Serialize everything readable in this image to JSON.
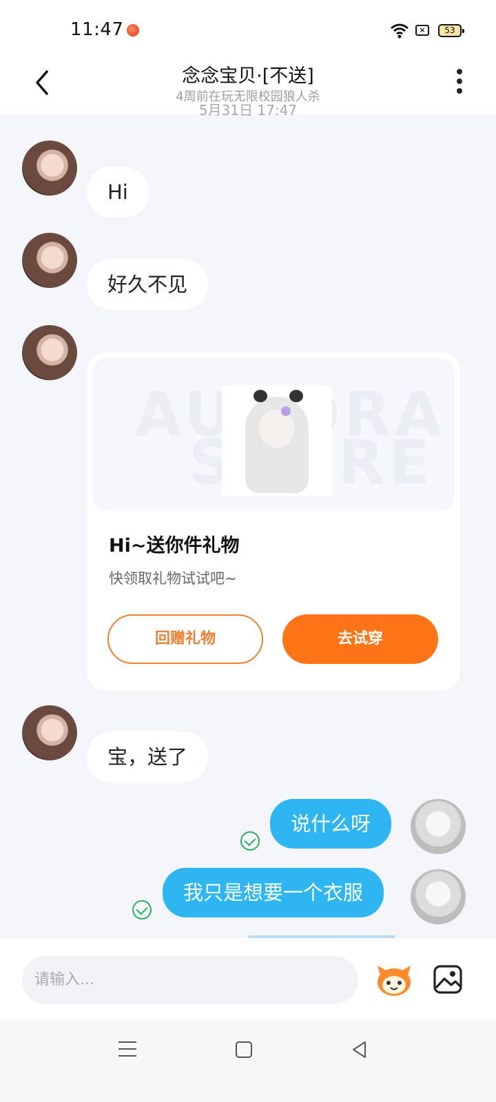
{
  "status_bar": {
    "time": "11:47",
    "battery": "53"
  },
  "header": {
    "title": "念念宝贝·[不送]",
    "subtitle": "4周前在玩无限校园狼人杀"
  },
  "timestamp": "5月31日 17:47",
  "messages": {
    "m1": "Hi",
    "m2": "好久不见",
    "m3": "宝，送了",
    "m4": "说什么呀",
    "m5": "我只是想要一个衣服"
  },
  "gift_card": {
    "watermark_line1": "AURORA",
    "watermark_line2": "STORE",
    "title": "Hi~送你件礼物",
    "description": "快领取礼物试试吧~",
    "return_gift_button": "回赠礼物",
    "try_on_button": "去试穿"
  },
  "input": {
    "placeholder": "请输入..."
  },
  "icons": {
    "back": "chevron-left-icon",
    "more": "more-vertical-icon",
    "read": "check-circle-icon",
    "emoji": "mascot-sticker-icon",
    "image": "image-icon"
  },
  "colors": {
    "accent_orange": "#ff7417",
    "outgoing_bubble": "#2eb6f3",
    "read_check": "#27b15d"
  }
}
